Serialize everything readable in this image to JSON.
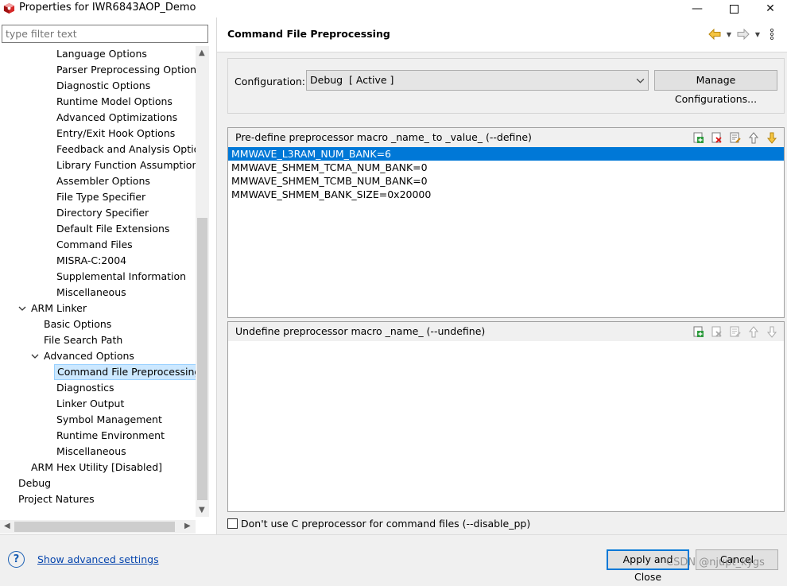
{
  "window": {
    "title": "Properties for IWR6843AOP_Demo",
    "controls": {
      "minimize": "—",
      "close": "✕"
    }
  },
  "filter": {
    "placeholder": "type filter text"
  },
  "tree": {
    "items": [
      "Language Options",
      "Parser Preprocessing Options",
      "Diagnostic Options",
      "Runtime Model Options",
      "Advanced Optimizations",
      "Entry/Exit Hook Options",
      "Feedback and Analysis Options",
      "Library Function Assumptions",
      "Assembler Options",
      "File Type Specifier",
      "Directory Specifier",
      "Default File Extensions",
      "Command Files",
      "MISRA-C:2004",
      "Supplemental Information",
      "Miscellaneous",
      "ARM Linker",
      "Basic Options",
      "File Search Path",
      "Advanced Options",
      "Command File Preprocessing",
      "Diagnostics",
      "Linker Output",
      "Symbol Management",
      "Runtime Environment",
      "Miscellaneous",
      "ARM Hex Utility  [Disabled]",
      "Debug",
      "Project Natures"
    ]
  },
  "page": {
    "title": "Command File Preprocessing",
    "config_label": "Configuration:",
    "config_value": "Debug  [ Active ]",
    "manage_button": "Manage Configurations..."
  },
  "define_list": {
    "title": "Pre-define preprocessor macro _name_ to _value_ (--define)",
    "rows": [
      "MMWAVE_L3RAM_NUM_BANK=6",
      "MMWAVE_SHMEM_TCMA_NUM_BANK=0",
      "MMWAVE_SHMEM_TCMB_NUM_BANK=0",
      "MMWAVE_SHMEM_BANK_SIZE=0x20000"
    ]
  },
  "undefine_list": {
    "title": "Undefine preprocessor macro _name_ (--undefine)",
    "rows": []
  },
  "disable_pp": {
    "label": "Don't use C preprocessor for command files (--disable_pp)",
    "checked": false
  },
  "footer": {
    "help": "?",
    "advanced_link": "Show advanced settings",
    "apply_button": "Apply and Close",
    "cancel_button": "Cancel",
    "watermark": "CSDN @njupt_kygs"
  },
  "colors": {
    "selection": "#0078d7",
    "tree_selection": "#cce8ff",
    "link": "#0645ad"
  }
}
